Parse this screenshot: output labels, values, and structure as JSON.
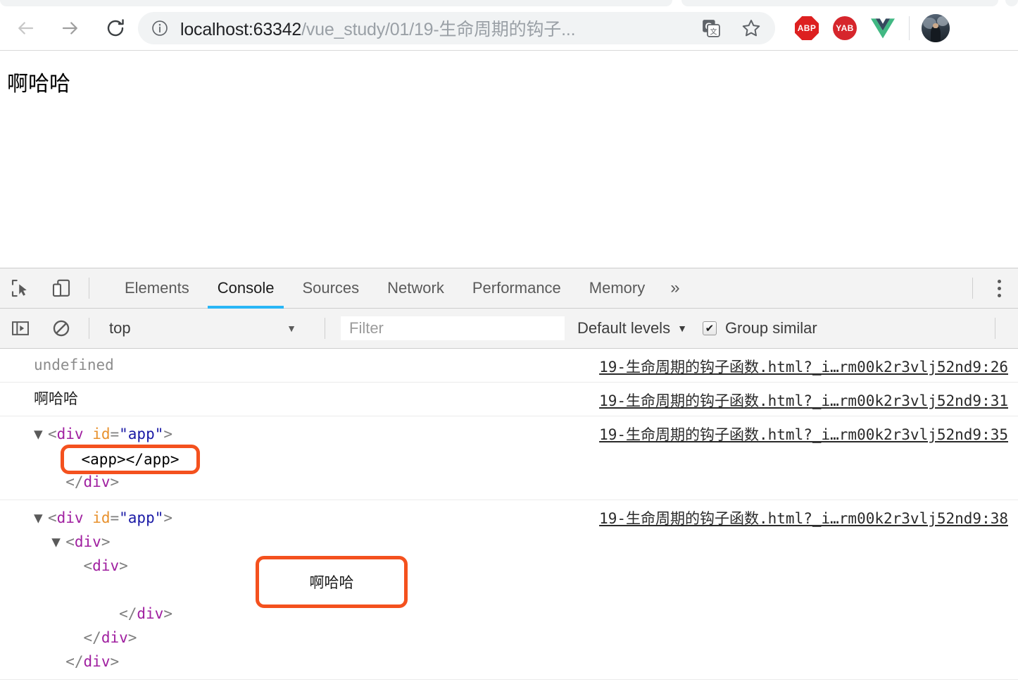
{
  "browser": {
    "nav": {
      "back_label": "Back",
      "forward_label": "Forward",
      "reload_label": "Reload"
    },
    "omnibox": {
      "info_icon": "info-circle-icon",
      "host": "localhost:63342",
      "path": "/vue_study/01/19-生命周期的钩子...",
      "translate_icon": "translate-icon",
      "star_icon": "bookmark-star-icon"
    },
    "extensions": [
      {
        "name": "adblock-plus",
        "label": "ABP",
        "shape": "octagon",
        "color": "#dd2020"
      },
      {
        "name": "yandex-adblock",
        "label": "YAB",
        "shape": "circle",
        "color": "#d6262c"
      },
      {
        "name": "vue-devtools",
        "label": "V",
        "shape": "vue-logo",
        "color": "#41b883"
      }
    ],
    "avatar": {
      "name": "profile-avatar"
    }
  },
  "page": {
    "heading": "啊哈哈"
  },
  "devtools": {
    "toolbar_icons": [
      {
        "name": "inspect-element-icon"
      },
      {
        "name": "device-toolbar-icon"
      }
    ],
    "tabs": [
      {
        "label": "Elements",
        "active": false
      },
      {
        "label": "Console",
        "active": true
      },
      {
        "label": "Sources",
        "active": false
      },
      {
        "label": "Network",
        "active": false
      },
      {
        "label": "Performance",
        "active": false
      },
      {
        "label": "Memory",
        "active": false
      }
    ],
    "more_tabs_icon": "»",
    "settings_icon": "vertical-dots-icon",
    "filterbar": {
      "sidebar_icon": "show-console-sidebar-icon",
      "clear_icon": "clear-console-icon",
      "context_value": "top",
      "context_caret": "▼",
      "filter_placeholder": "Filter",
      "filter_value": "",
      "levels_label": "Default levels",
      "levels_caret": "▼",
      "group_similar_label": "Group similar",
      "group_similar_checked": true,
      "checkmark": "✔"
    },
    "messages": [
      {
        "kind": "text",
        "style": "undefined",
        "text": "undefined",
        "source": "19-生命周期的钩子函数.html?_i…rm00k2r3vlj52nd9:26"
      },
      {
        "kind": "text",
        "style": "cjk",
        "text": "啊哈哈",
        "source": "19-生命周期的钩子函数.html?_i…rm00k2r3vlj52nd9:31"
      },
      {
        "kind": "dom",
        "source": "19-生命周期的钩子函数.html?_i…rm00k2r3vlj52nd9:35",
        "lines": [
          {
            "indent": 0,
            "arrow": "▼",
            "segments": [
              {
                "t": "<",
                "c": "tw"
              },
              {
                "t": "div",
                "c": "tag"
              },
              {
                "t": " ",
                "c": "tw"
              },
              {
                "t": "id",
                "c": "attr"
              },
              {
                "t": "=",
                "c": "tw"
              },
              {
                "t": "\"app\"",
                "c": "val"
              },
              {
                "t": ">",
                "c": "tw"
              }
            ]
          },
          {
            "indent": 1,
            "arrow": "",
            "segments": [
              {
                "t": "<",
                "c": "tw"
              },
              {
                "t": "app",
                "c": "tag"
              },
              {
                "t": ">",
                "c": "tw"
              },
              {
                "t": "</",
                "c": "tw"
              },
              {
                "t": "app",
                "c": "tag"
              },
              {
                "t": ">",
                "c": "tw"
              }
            ]
          },
          {
            "indent": 1,
            "arrow": "",
            "segments": [
              {
                "t": "</",
                "c": "tw"
              },
              {
                "t": "div",
                "c": "tag"
              },
              {
                "t": ">",
                "c": "tw"
              }
            ]
          }
        ]
      },
      {
        "kind": "dom",
        "source": "19-生命周期的钩子函数.html?_i…rm00k2r3vlj52nd9:38",
        "lines": [
          {
            "indent": 0,
            "arrow": "▼",
            "segments": [
              {
                "t": "<",
                "c": "tw"
              },
              {
                "t": "div",
                "c": "tag"
              },
              {
                "t": " ",
                "c": "tw"
              },
              {
                "t": "id",
                "c": "attr"
              },
              {
                "t": "=",
                "c": "tw"
              },
              {
                "t": "\"app\"",
                "c": "val"
              },
              {
                "t": ">",
                "c": "tw"
              }
            ]
          },
          {
            "indent": 1,
            "arrow": "▼",
            "segments": [
              {
                "t": "<",
                "c": "tw"
              },
              {
                "t": "div",
                "c": "tag"
              },
              {
                "t": ">",
                "c": "tw"
              }
            ]
          },
          {
            "indent": 2,
            "arrow": "",
            "segments": [
              {
                "t": "<",
                "c": "tw"
              },
              {
                "t": "div",
                "c": "tag"
              },
              {
                "t": ">",
                "c": "tw"
              }
            ]
          },
          {
            "indent": 3,
            "arrow": "",
            "segments": [
              {
                "t": "",
                "c": "tw"
              }
            ]
          },
          {
            "indent": 4,
            "arrow": "",
            "segments": [
              {
                "t": "</",
                "c": "tw"
              },
              {
                "t": "div",
                "c": "tag"
              },
              {
                "t": ">",
                "c": "tw"
              }
            ]
          },
          {
            "indent": 2,
            "arrow": "",
            "segments": [
              {
                "t": "</",
                "c": "tw"
              },
              {
                "t": "div",
                "c": "tag"
              },
              {
                "t": ">",
                "c": "tw"
              }
            ]
          },
          {
            "indent": 1,
            "arrow": "",
            "segments": [
              {
                "t": "</",
                "c": "tw"
              },
              {
                "t": "div",
                "c": "tag"
              },
              {
                "t": ">",
                "c": "tw"
              }
            ]
          }
        ]
      }
    ],
    "annotations": [
      {
        "name": "annotation-app-tag",
        "text": "<app></app>",
        "kind": "code",
        "color": "#f4511e"
      },
      {
        "name": "annotation-text-content",
        "text": "啊哈哈",
        "kind": "cjk",
        "color": "#f4511e"
      }
    ]
  }
}
